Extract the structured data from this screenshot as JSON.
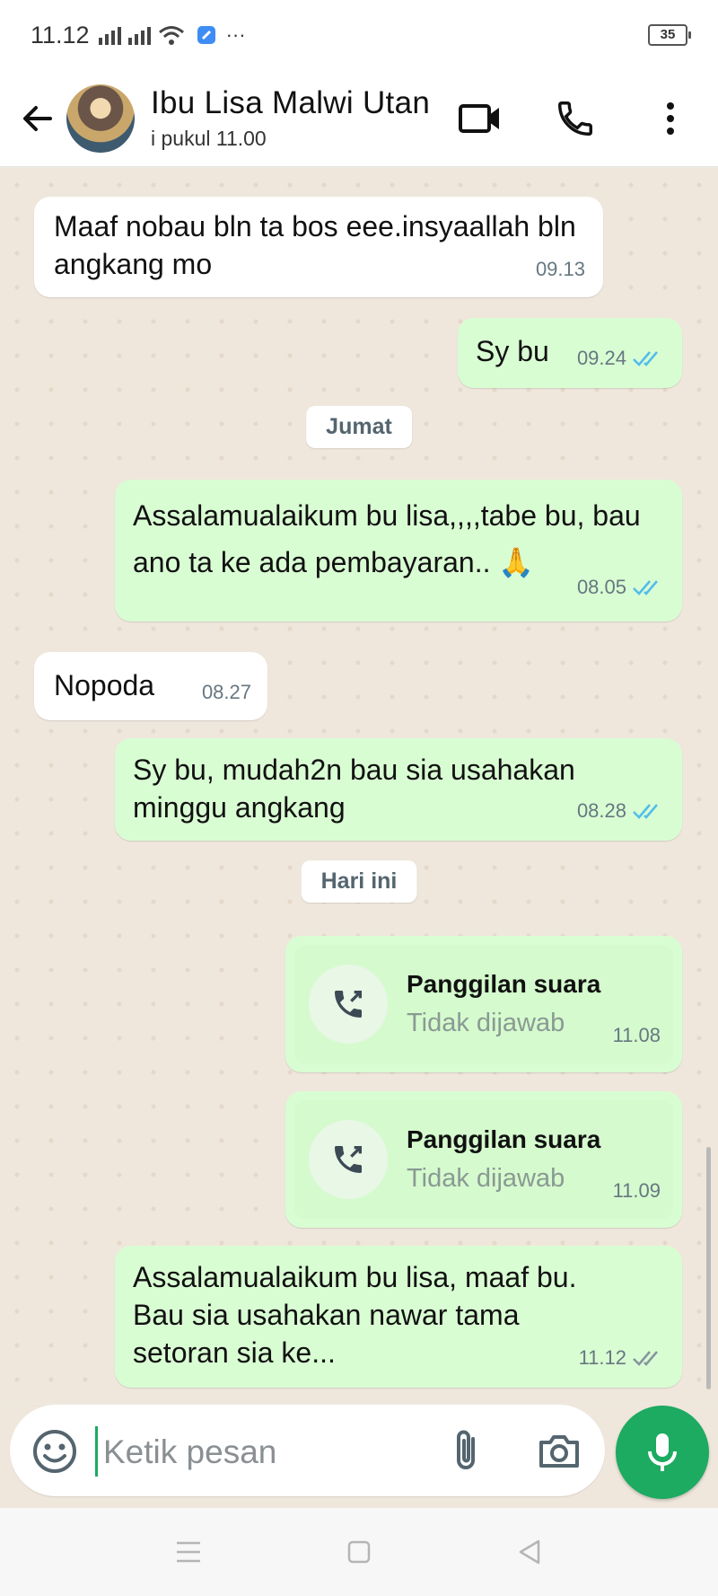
{
  "status_bar": {
    "time": "11.12",
    "dots": "···",
    "battery": "35"
  },
  "header": {
    "contact_name": "Ibu Lisa Malwi Utan",
    "last_seen": "i pukul 11.00"
  },
  "messages": [
    {
      "dir": "in",
      "text": "Maaf nobau bln ta bos eee.insyaallah bln angkang mo",
      "time": "09.13"
    },
    {
      "dir": "out",
      "text": "Sy bu",
      "time": "09.24",
      "status": "read"
    },
    {
      "dir": "out",
      "text": "Assalamualaikum bu lisa,,,,tabe bu, bau ano ta ke ada pembayaran.. 🙏",
      "time": "08.05",
      "status": "read"
    },
    {
      "dir": "in",
      "text": "Nopoda",
      "time": "08.27"
    },
    {
      "dir": "out",
      "text": "Sy bu, mudah2n bau sia usahakan minggu angkang",
      "time": "08.28",
      "status": "read"
    },
    {
      "dir": "out",
      "call_title": "Panggilan suara",
      "call_sub": "Tidak dijawab",
      "time": "11.08"
    },
    {
      "dir": "out",
      "call_title": "Panggilan suara",
      "call_sub": "Tidak dijawab",
      "time": "11.09"
    },
    {
      "dir": "out",
      "text": "Assalamualaikum bu lisa, maaf bu. Bau sia usahakan nawar tama setoran sia ke...",
      "time": "11.12",
      "status": "delivered"
    }
  ],
  "date_dividers": [
    "Jumat",
    "Hari ini"
  ],
  "composer": {
    "placeholder": "Ketik pesan"
  },
  "colors": {
    "accent": "#1daa61",
    "outgoing_bubble": "#d9fdd3",
    "incoming_bubble": "#ffffff",
    "read_tick": "#53bdeb",
    "sent_tick": "#8696a0"
  },
  "icons": [
    "back-arrow-icon",
    "video-call-icon",
    "phone-icon",
    "more-vert-icon",
    "emoji-icon",
    "attach-icon",
    "camera-icon",
    "mic-icon",
    "call-outgoing-icon",
    "double-check-icon",
    "nav-menu-icon",
    "nav-home-icon",
    "nav-back-icon"
  ]
}
